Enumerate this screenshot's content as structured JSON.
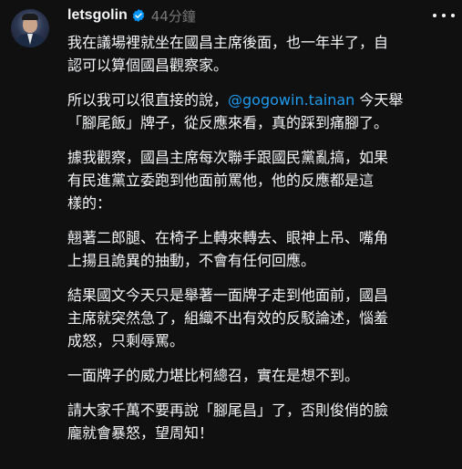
{
  "post": {
    "username": "letsgolin",
    "timestamp": "44分鐘",
    "verified": true,
    "icons": {
      "verified": "verified-badge-icon",
      "more": "more-options-icon"
    },
    "colors": {
      "background": "#101010",
      "text": "#f3f5f7",
      "muted": "#777777",
      "mention": "#1d9bf0",
      "verified": "#0095f6"
    },
    "paragraphs": [
      {
        "text": "我在議場裡就坐在國昌主席後面，也一年半了，自\n認可以算個國昌觀察家。"
      },
      {
        "before": "所以我可以很直接的說，",
        "mention": "@gogowin.tainan",
        "after": " 今天舉\n「腳尾飯」牌子，從反應來看，真的踩到痛腳了。"
      },
      {
        "text": "據我觀察，國昌主席每次聯手跟國民黨亂搞，如果\n有民進黨立委跑到他面前罵他，他的反應都是這\n樣的："
      },
      {
        "text": "翹著二郎腿、在椅子上轉來轉去、眼神上吊、嘴角\n上揚且詭異的抽動，不會有任何回應。"
      },
      {
        "text": "結果國文今天只是舉著一面牌子走到他面前，國昌\n主席就突然急了，組織不出有效的反駁論述，惱羞\n成怒，只剩辱罵。"
      },
      {
        "text": "一面牌子的威力堪比柯總召，實在是想不到。"
      },
      {
        "text": "請大家千萬不要再說「腳尾昌」了，否則俊俏的臉\n龐就會暴怒，望周知！"
      }
    ]
  }
}
